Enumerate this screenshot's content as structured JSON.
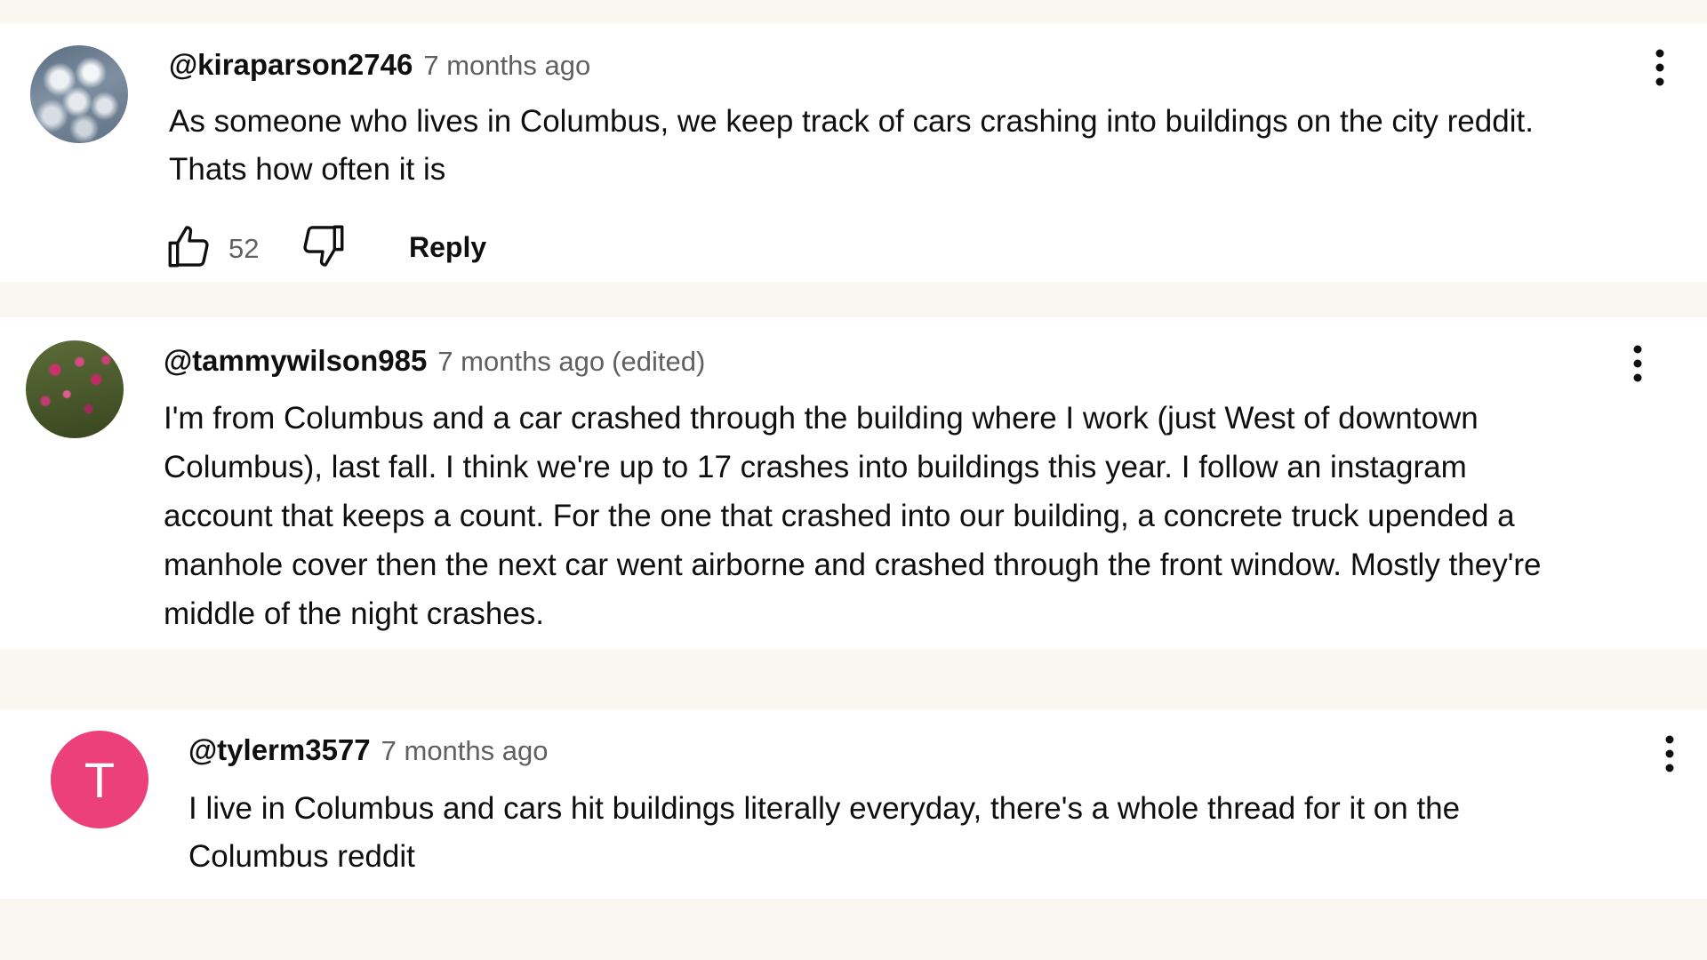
{
  "comments": [
    {
      "author": "@kiraparson2746",
      "time": "7 months ago",
      "text": "As someone who lives in Columbus, we keep track of cars crashing into buildings on the city reddit.\nThats how often it is",
      "likes": "52",
      "reply_label": "Reply",
      "avatar": "clouds-photo"
    },
    {
      "author": "@tammywilson985",
      "time": "7 months ago",
      "edited": "(edited)",
      "text": "I'm from Columbus and a car crashed through the building where I work (just West of downtown\nColumbus), last fall. I think we're up to 17 crashes into buildings this year. I follow an instagram\naccount that keeps a count. For the one that crashed into our building, a concrete truck upended a\nmanhole cover then the next car went airborne and crashed through the front window. Mostly they're\nmiddle of the night crashes.",
      "avatar": "pink-flowers-photo"
    },
    {
      "author": "@tylerm3577",
      "time": "7 months ago",
      "text": "I live in Columbus and cars hit buildings literally everyday, there's a whole thread for it on the\nColumbus reddit",
      "avatar_letter": "T",
      "avatar_color": "#ec407a"
    }
  ],
  "icons": {
    "more": "vertical-dots-icon",
    "like": "thumbs-up-icon",
    "dislike": "thumbs-down-icon"
  },
  "colors": {
    "page_background": "#faf7f1",
    "card_background": "#ffffff",
    "secondary_text": "#606060"
  }
}
